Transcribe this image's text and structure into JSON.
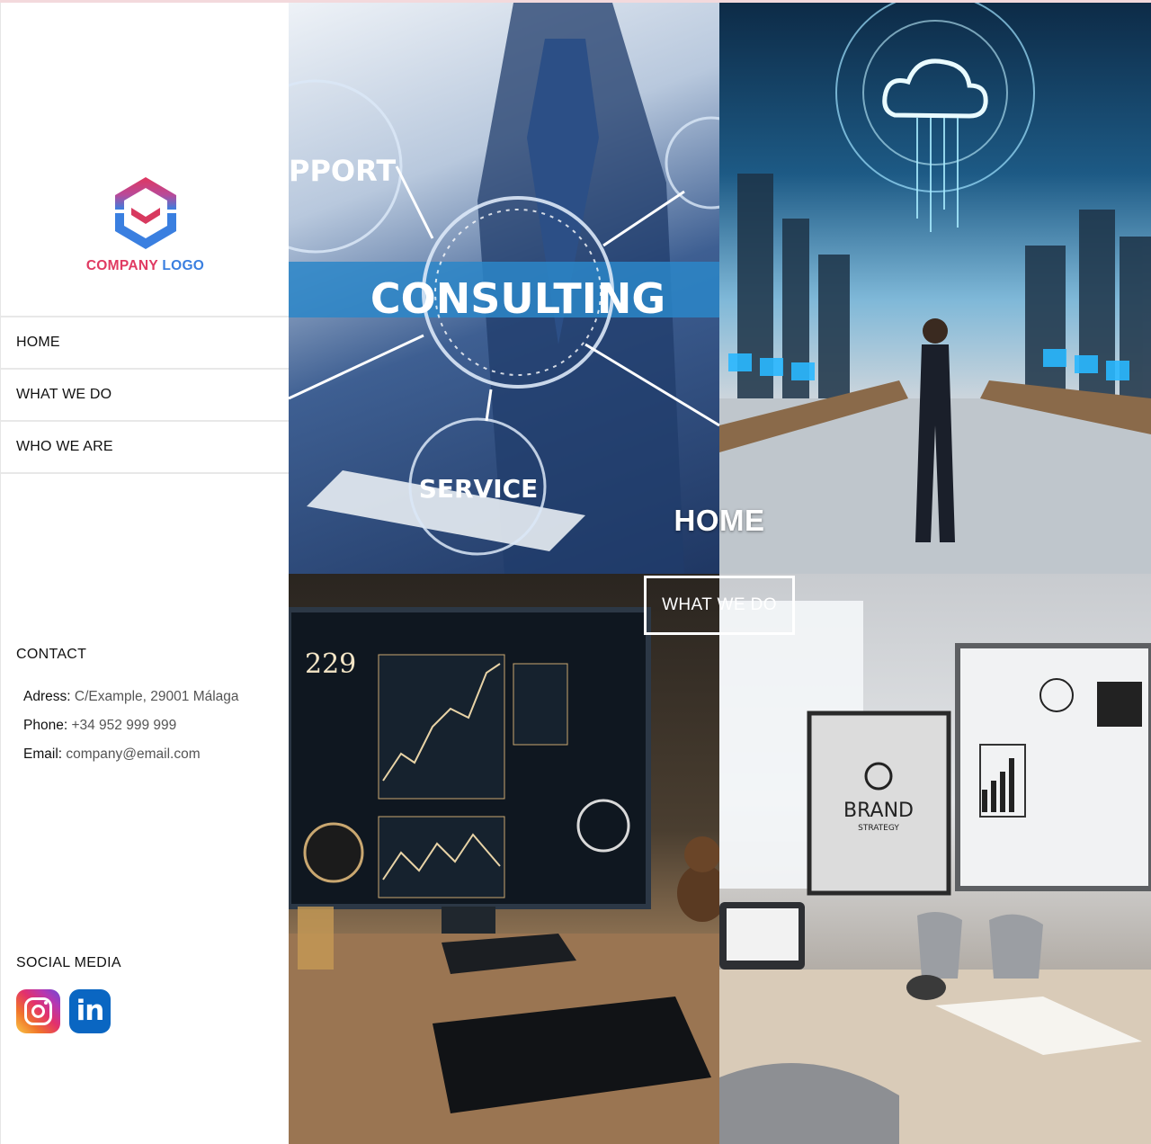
{
  "brand": {
    "logo_word1": "COMPANY",
    "logo_word2": "LOGO",
    "logo_colors": {
      "pink": "#e03a62",
      "blue": "#3a7fe0"
    }
  },
  "nav": {
    "items": [
      {
        "label": "HOME"
      },
      {
        "label": "WHAT WE DO"
      },
      {
        "label": "WHO WE ARE"
      }
    ]
  },
  "contact": {
    "title": "CONTACT",
    "address_label": "Adress:",
    "address_value": "C/Example, 29001 Málaga",
    "phone_label": "Phone:",
    "phone_value": "+34 952 999 999",
    "email_label": "Email:",
    "email_value": "company@email.com"
  },
  "social": {
    "title": "SOCIAL MEDIA",
    "icons": [
      "instagram-icon",
      "linkedin-icon"
    ],
    "linkedin_text": "in"
  },
  "hero": {
    "consulting_text": "CONSULTING",
    "support_text": "PPORT",
    "service_text": "SERVICE",
    "brand_text": "BRAND",
    "brand_sub": "STRATEGY",
    "screen_number": "229",
    "home_label": "HOME",
    "what_we_do_button": "WHAT WE DO"
  }
}
